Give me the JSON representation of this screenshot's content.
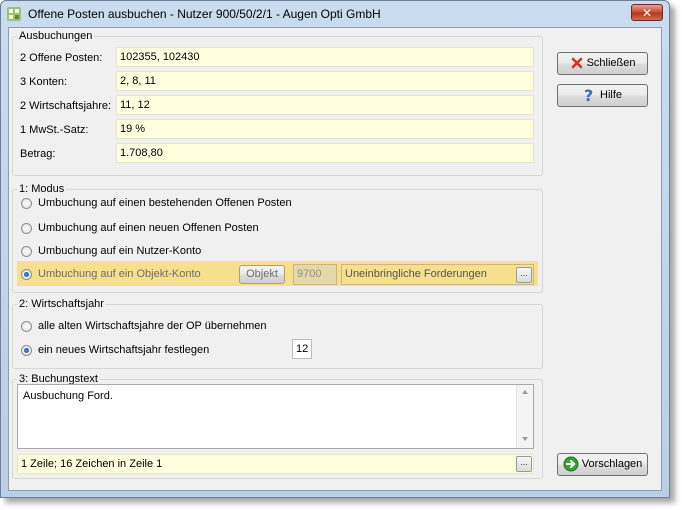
{
  "window": {
    "title": "Offene Posten ausbuchen - Nutzer 900/50/2/1 - Augen Opti GmbH",
    "close_symbol": "✕"
  },
  "ausbuchungen": {
    "title": "Ausbuchungen",
    "rows": [
      {
        "label": "2 Offene Posten:",
        "value": "102355,  102430"
      },
      {
        "label": "3 Konten:",
        "value": "2,  8,  11"
      },
      {
        "label": "2 Wirtschaftsjahre:",
        "value": "11,  12"
      },
      {
        "label": "1 MwSt.-Satz:",
        "value": "19 %"
      },
      {
        "label": "Betrag:",
        "value": "1.708,80"
      }
    ]
  },
  "modus": {
    "title": "1: Modus",
    "options": [
      {
        "label": "Umbuchung auf einen bestehenden Offenen Posten",
        "checked": false
      },
      {
        "label": "Umbuchung auf einen neuen Offenen Posten",
        "checked": false
      },
      {
        "label": "Umbuchung auf ein Nutzer-Konto",
        "checked": false
      },
      {
        "label": "Umbuchung auf ein Objekt-Konto",
        "checked": true
      }
    ],
    "objekt_button": "Objekt",
    "objekt_number": "9700",
    "objekt_name": "Uneinbringliche Forderungen",
    "ellipsis": "..."
  },
  "wirtschaftsjahr": {
    "title": "2: Wirtschaftsjahr",
    "options": [
      {
        "label": "alle alten Wirtschaftsjahre der OP übernehmen",
        "checked": false
      },
      {
        "label": "ein neues Wirtschaftsjahr festlegen",
        "checked": true
      }
    ],
    "year_value": "12"
  },
  "buchungstext": {
    "title": "3: Buchungstext",
    "text": "Ausbuchung Ford.",
    "status": "1 Zeile; 16 Zeichen in Zeile 1",
    "ellipsis": "..."
  },
  "buttons": {
    "schliessen": "Schließen",
    "hilfe": "Hilfe",
    "vorschlagen": "Vorschlagen"
  },
  "colors": {
    "field_bg": "#ffffe0",
    "highlight": "#f6df8d",
    "close_red": "#c7472f"
  }
}
